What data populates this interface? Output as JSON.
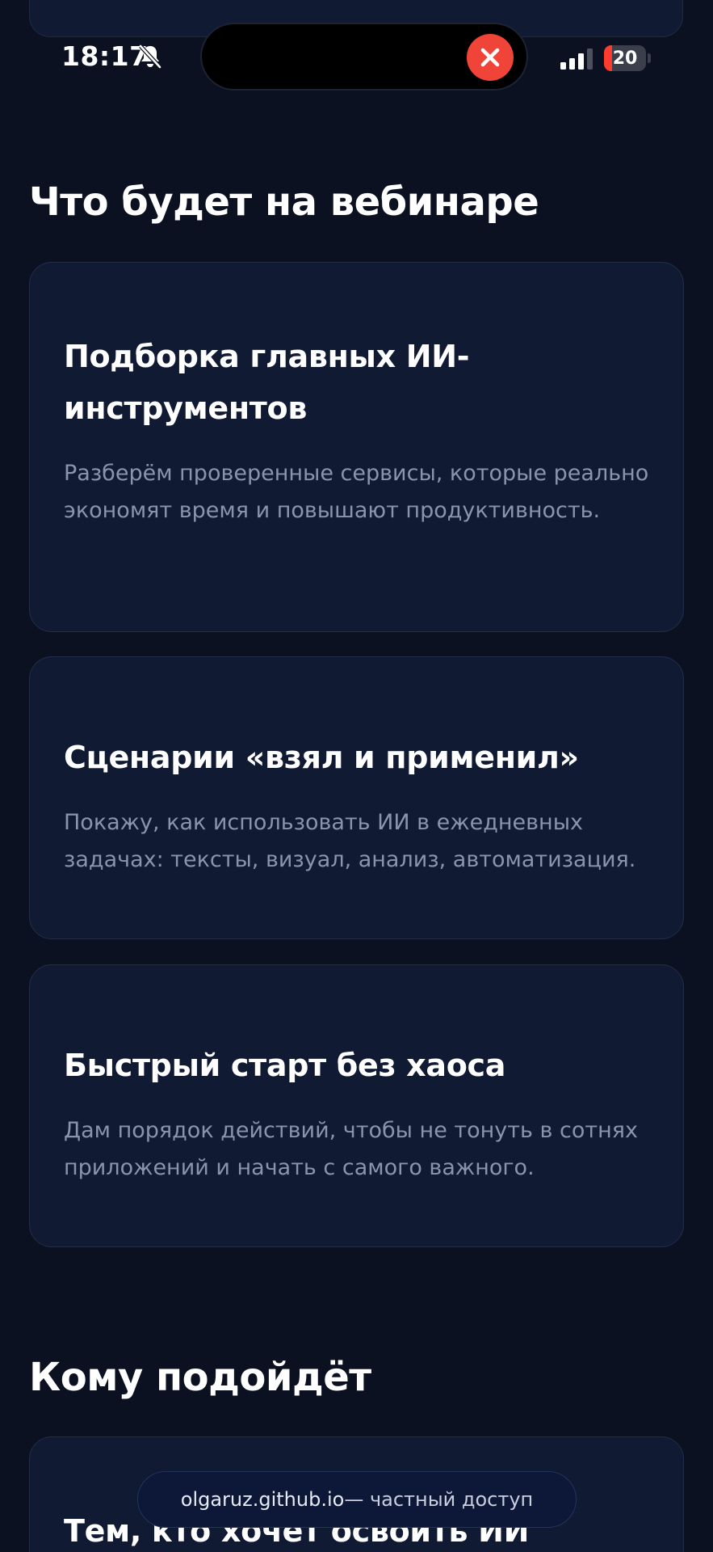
{
  "status_bar": {
    "time": "18:17",
    "battery_level": "20",
    "battery_fraction": 0.2,
    "icons": [
      "bell-slash-icon",
      "close-icon",
      "signal-icon",
      "battery-icon"
    ]
  },
  "sections": {
    "webinar": {
      "title": "Что будет на вебинаре",
      "cards": [
        {
          "title": "Подборка главных ИИ-инструментов",
          "text": "Разберём проверенные сервисы, которые реально экономят время и повышают продуктивность."
        },
        {
          "title": "Сценарии «взял и применил»",
          "text": "Покажу, как использовать ИИ в ежедневных задачах: тексты, визуал, анализ, автоматизация."
        },
        {
          "title": "Быстрый старт без хаоса",
          "text": "Дам порядок действий, чтобы не тонуть в сотнях приложений и начать с самого важного."
        }
      ]
    },
    "audience": {
      "title": "Кому подойдёт",
      "cards": [
        {
          "title": "Тем, кто хочет освоить ИИ быстро"
        }
      ]
    }
  },
  "toast": {
    "domain": "olgaruz.github.io",
    "suffix": " — частный доступ"
  },
  "colors": {
    "background": "#0b1120",
    "card": "#111a33",
    "card_border": "#222d49",
    "muted_text": "#8a94ad",
    "close_red": "#f04438"
  }
}
